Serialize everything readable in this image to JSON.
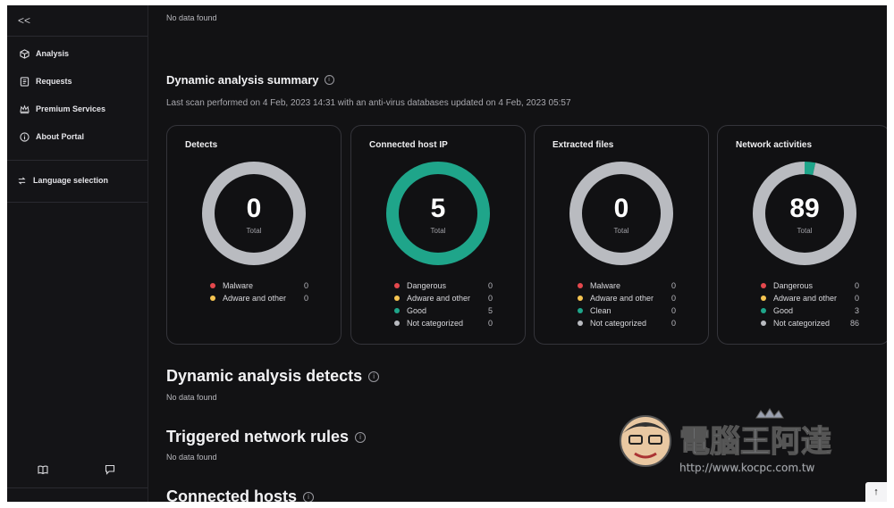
{
  "sidebar": {
    "collapse_label": "<<",
    "items": [
      {
        "label": "Analysis",
        "icon": "cube-icon"
      },
      {
        "label": "Requests",
        "icon": "document-icon"
      },
      {
        "label": "Premium Services",
        "icon": "crown-icon"
      },
      {
        "label": "About Portal",
        "icon": "info-icon"
      }
    ],
    "language_label": "Language selection",
    "bottom_icons": [
      "book-icon",
      "chat-icon"
    ]
  },
  "main": {
    "top_nodata": "No data found",
    "summary": {
      "title": "Dynamic analysis summary",
      "scan_info": "Last scan performed on 4 Feb, 2023 14:31 with an anti-virus databases updated on 4 Feb, 2023 05:57"
    },
    "cards": [
      {
        "title": "Detects",
        "total": "0",
        "total_label": "Total",
        "segments": [
          {
            "color": "#b9bbc0",
            "value": 1
          }
        ],
        "legend": [
          {
            "label": "Malware",
            "value": "0",
            "color": "#e5484d"
          },
          {
            "label": "Adware and other",
            "value": "0",
            "color": "#f5c451"
          }
        ]
      },
      {
        "title": "Connected host IP",
        "total": "5",
        "total_label": "Total",
        "segments": [
          {
            "color": "#1fa58a",
            "value": 1
          }
        ],
        "legend": [
          {
            "label": "Dangerous",
            "value": "0",
            "color": "#e5484d"
          },
          {
            "label": "Adware and other",
            "value": "0",
            "color": "#f5c451"
          },
          {
            "label": "Good",
            "value": "5",
            "color": "#1fa58a"
          },
          {
            "label": "Not categorized",
            "value": "0",
            "color": "#b9bbc0"
          }
        ]
      },
      {
        "title": "Extracted files",
        "total": "0",
        "total_label": "Total",
        "segments": [
          {
            "color": "#b9bbc0",
            "value": 1
          }
        ],
        "legend": [
          {
            "label": "Malware",
            "value": "0",
            "color": "#e5484d"
          },
          {
            "label": "Adware and other",
            "value": "0",
            "color": "#f5c451"
          },
          {
            "label": "Clean",
            "value": "0",
            "color": "#1fa58a"
          },
          {
            "label": "Not categorized",
            "value": "0",
            "color": "#b9bbc0"
          }
        ]
      },
      {
        "title": "Network activities",
        "total": "89",
        "total_label": "Total",
        "segments": [
          {
            "color": "#1fa58a",
            "value": 3
          },
          {
            "color": "#b9bbc0",
            "value": 86
          }
        ],
        "legend": [
          {
            "label": "Dangerous",
            "value": "0",
            "color": "#e5484d"
          },
          {
            "label": "Adware and other",
            "value": "0",
            "color": "#f5c451"
          },
          {
            "label": "Good",
            "value": "3",
            "color": "#1fa58a"
          },
          {
            "label": "Not categorized",
            "value": "86",
            "color": "#b9bbc0"
          }
        ]
      }
    ],
    "detects": {
      "title": "Dynamic analysis detects",
      "nodata": "No data found"
    },
    "rules": {
      "title": "Triggered network rules",
      "nodata": "No data found"
    },
    "hosts": {
      "title": "Connected hosts"
    }
  },
  "watermark": {
    "text": "電腦王阿達",
    "url": "http://www.kocpc.com.tw"
  },
  "scroll_top_label": "↑"
}
